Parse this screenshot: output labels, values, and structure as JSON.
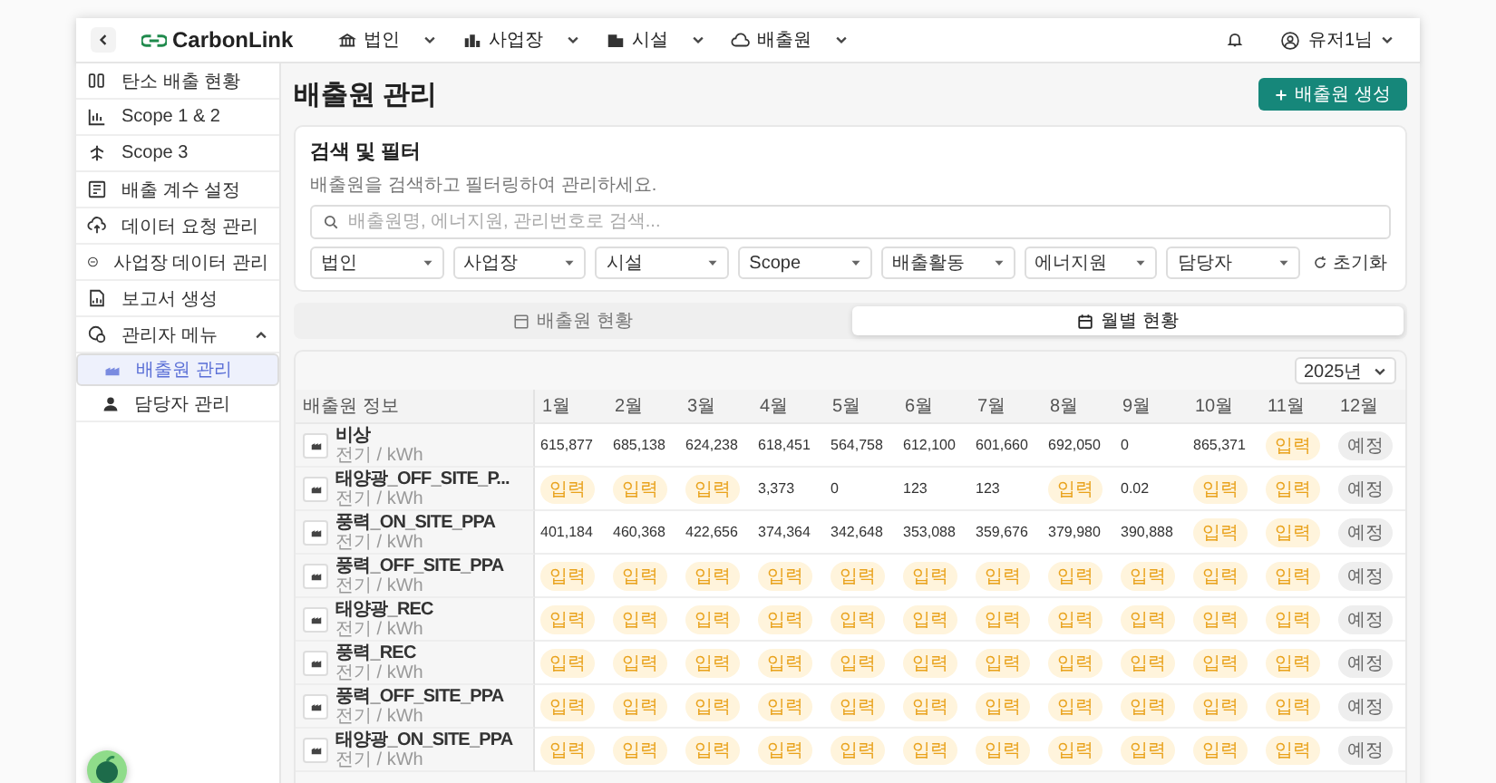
{
  "topbar": {
    "logo": "CarbonLink",
    "nav": [
      {
        "label": "법인"
      },
      {
        "label": "사업장"
      },
      {
        "label": "시설"
      },
      {
        "label": "배출원"
      }
    ],
    "user": "유저1님"
  },
  "sidebar": {
    "items": [
      {
        "label": "탄소 배출 현황",
        "selected": false
      },
      {
        "label": "Scope 1 & 2",
        "selected": false
      },
      {
        "label": "Scope 3",
        "selected": false
      },
      {
        "label": "배출 계수 설정",
        "selected": false
      },
      {
        "label": "데이터 요청 관리",
        "selected": false
      },
      {
        "label": "사업장 데이터 관리",
        "selected": false
      },
      {
        "label": "보고서 생성",
        "selected": false
      },
      {
        "label": "관리자 메뉴",
        "selected": false,
        "expanded": true,
        "children": [
          {
            "label": "배출원 관리",
            "selected": true
          },
          {
            "label": "담당자 관리",
            "selected": false
          }
        ]
      }
    ]
  },
  "page": {
    "title": "배출원 관리",
    "create_button": "배출원 생성"
  },
  "filter": {
    "title": "검색 및 필터",
    "description": "배출원을 검색하고 필터링하여 관리하세요.",
    "search": {
      "placeholder": "배출원명, 에너지원, 관리번호로 검색..."
    },
    "selects": [
      "법인",
      "사업장",
      "시설",
      "Scope",
      "배출활동",
      "에너지원",
      "담당자"
    ],
    "reset": "초기화"
  },
  "tabs": [
    {
      "label": "배출원 현황",
      "selected": false
    },
    {
      "label": "월별 현황",
      "selected": true
    }
  ],
  "table": {
    "year": "2025년",
    "columns": [
      "배출원 정보",
      "1월",
      "2월",
      "3월",
      "4월",
      "5월",
      "6월",
      "7월",
      "8월",
      "9월",
      "10월",
      "11월",
      "12월"
    ],
    "rows": [
      {
        "cells": [
          {
            "kind": "source",
            "name": "비상",
            "unit": "전기 / kWh"
          },
          {
            "kind": "value",
            "text": "615,877"
          },
          {
            "kind": "value",
            "text": "685,138"
          },
          {
            "kind": "value",
            "text": "624,238"
          },
          {
            "kind": "value",
            "text": "618,451"
          },
          {
            "kind": "value",
            "text": "564,758"
          },
          {
            "kind": "value",
            "text": "612,100"
          },
          {
            "kind": "value",
            "text": "601,660"
          },
          {
            "kind": "value",
            "text": "692,050"
          },
          {
            "kind": "value",
            "text": "0"
          },
          {
            "kind": "value",
            "text": "865,371"
          },
          {
            "kind": "input",
            "text": "입력"
          },
          {
            "kind": "planned",
            "text": "예정"
          }
        ]
      },
      {
        "cells": [
          {
            "kind": "source",
            "name": "태양광_OFF_SITE_P...",
            "unit": "전기 / kWh"
          },
          {
            "kind": "input",
            "text": "입력"
          },
          {
            "kind": "input",
            "text": "입력"
          },
          {
            "kind": "input",
            "text": "입력"
          },
          {
            "kind": "value",
            "text": "3,373"
          },
          {
            "kind": "value",
            "text": "0"
          },
          {
            "kind": "value",
            "text": "123"
          },
          {
            "kind": "value",
            "text": "123"
          },
          {
            "kind": "input",
            "text": "입력"
          },
          {
            "kind": "value",
            "text": "0.02"
          },
          {
            "kind": "input",
            "text": "입력"
          },
          {
            "kind": "input",
            "text": "입력"
          },
          {
            "kind": "planned",
            "text": "예정"
          }
        ]
      },
      {
        "cells": [
          {
            "kind": "source",
            "name": "풍력_ON_SITE_PPA",
            "unit": "전기 / kWh"
          },
          {
            "kind": "value",
            "text": "401,184"
          },
          {
            "kind": "value",
            "text": "460,368"
          },
          {
            "kind": "value",
            "text": "422,656"
          },
          {
            "kind": "value",
            "text": "374,364"
          },
          {
            "kind": "value",
            "text": "342,648"
          },
          {
            "kind": "value",
            "text": "353,088"
          },
          {
            "kind": "value",
            "text": "359,676"
          },
          {
            "kind": "value",
            "text": "379,980"
          },
          {
            "kind": "value",
            "text": "390,888"
          },
          {
            "kind": "input",
            "text": "입력"
          },
          {
            "kind": "input",
            "text": "입력"
          },
          {
            "kind": "planned",
            "text": "예정"
          }
        ]
      },
      {
        "cells": [
          {
            "kind": "source",
            "name": "풍력_OFF_SITE_PPA",
            "unit": "전기 / kWh"
          },
          {
            "kind": "input",
            "text": "입력"
          },
          {
            "kind": "input",
            "text": "입력"
          },
          {
            "kind": "input",
            "text": "입력"
          },
          {
            "kind": "input",
            "text": "입력"
          },
          {
            "kind": "input",
            "text": "입력"
          },
          {
            "kind": "input",
            "text": "입력"
          },
          {
            "kind": "input",
            "text": "입력"
          },
          {
            "kind": "input",
            "text": "입력"
          },
          {
            "kind": "input",
            "text": "입력"
          },
          {
            "kind": "input",
            "text": "입력"
          },
          {
            "kind": "input",
            "text": "입력"
          },
          {
            "kind": "planned",
            "text": "예정"
          }
        ]
      },
      {
        "cells": [
          {
            "kind": "source",
            "name": "태양광_REC",
            "unit": "전기 / kWh"
          },
          {
            "kind": "input",
            "text": "입력"
          },
          {
            "kind": "input",
            "text": "입력"
          },
          {
            "kind": "input",
            "text": "입력"
          },
          {
            "kind": "input",
            "text": "입력"
          },
          {
            "kind": "input",
            "text": "입력"
          },
          {
            "kind": "input",
            "text": "입력"
          },
          {
            "kind": "input",
            "text": "입력"
          },
          {
            "kind": "input",
            "text": "입력"
          },
          {
            "kind": "input",
            "text": "입력"
          },
          {
            "kind": "input",
            "text": "입력"
          },
          {
            "kind": "input",
            "text": "입력"
          },
          {
            "kind": "planned",
            "text": "예정"
          }
        ]
      },
      {
        "cells": [
          {
            "kind": "source",
            "name": "풍력_REC",
            "unit": "전기 / kWh"
          },
          {
            "kind": "input",
            "text": "입력"
          },
          {
            "kind": "input",
            "text": "입력"
          },
          {
            "kind": "input",
            "text": "입력"
          },
          {
            "kind": "input",
            "text": "입력"
          },
          {
            "kind": "input",
            "text": "입력"
          },
          {
            "kind": "input",
            "text": "입력"
          },
          {
            "kind": "input",
            "text": "입력"
          },
          {
            "kind": "input",
            "text": "입력"
          },
          {
            "kind": "input",
            "text": "입력"
          },
          {
            "kind": "input",
            "text": "입력"
          },
          {
            "kind": "input",
            "text": "입력"
          },
          {
            "kind": "planned",
            "text": "예정"
          }
        ]
      },
      {
        "cells": [
          {
            "kind": "source",
            "name": "풍력_OFF_SITE_PPA",
            "unit": "전기 / kWh"
          },
          {
            "kind": "input",
            "text": "입력"
          },
          {
            "kind": "input",
            "text": "입력"
          },
          {
            "kind": "input",
            "text": "입력"
          },
          {
            "kind": "input",
            "text": "입력"
          },
          {
            "kind": "input",
            "text": "입력"
          },
          {
            "kind": "input",
            "text": "입력"
          },
          {
            "kind": "input",
            "text": "입력"
          },
          {
            "kind": "input",
            "text": "입력"
          },
          {
            "kind": "input",
            "text": "입력"
          },
          {
            "kind": "input",
            "text": "입력"
          },
          {
            "kind": "input",
            "text": "입력"
          },
          {
            "kind": "planned",
            "text": "예정"
          }
        ]
      },
      {
        "cells": [
          {
            "kind": "source",
            "name": "태양광_ON_SITE_PPA",
            "unit": "전기 / kWh"
          },
          {
            "kind": "input",
            "text": "입력"
          },
          {
            "kind": "input",
            "text": "입력"
          },
          {
            "kind": "input",
            "text": "입력"
          },
          {
            "kind": "input",
            "text": "입력"
          },
          {
            "kind": "input",
            "text": "입력"
          },
          {
            "kind": "input",
            "text": "입력"
          },
          {
            "kind": "input",
            "text": "입력"
          },
          {
            "kind": "input",
            "text": "입력"
          },
          {
            "kind": "input",
            "text": "입력"
          },
          {
            "kind": "input",
            "text": "입력"
          },
          {
            "kind": "input",
            "text": "입력"
          },
          {
            "kind": "planned",
            "text": "예정"
          }
        ]
      }
    ]
  }
}
